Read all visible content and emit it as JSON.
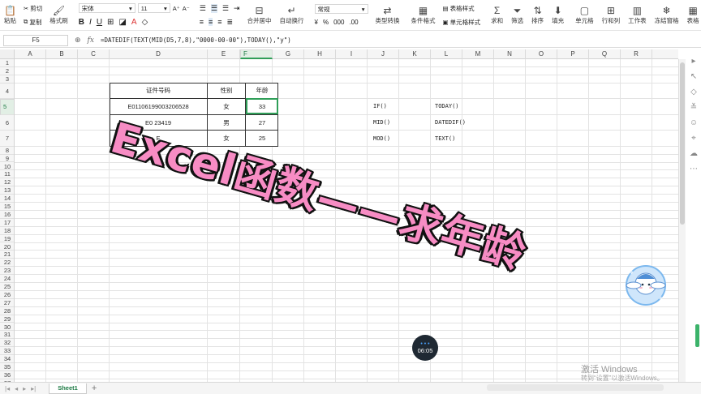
{
  "ribbon": {
    "paste": "粘贴",
    "cut": "剪切",
    "copy": "复制",
    "format_painter": "格式刷",
    "font_name": "宋体",
    "font_size": "11",
    "merge_center": "合并居中",
    "wrap_text": "自动换行",
    "number_format": "常规",
    "type_convert": "类型转换",
    "cond_format": "条件格式",
    "table_style": "表格样式",
    "cell_style": "单元格样式",
    "sum": "求和",
    "filter": "筛选",
    "sort": "排序",
    "fill": "填充",
    "cell": "单元格",
    "row_col": "行和列",
    "worksheet": "工作表",
    "freeze": "冻结窗格",
    "table_tools": "表格"
  },
  "formula_bar": {
    "cell_ref": "F5",
    "fx": "fx",
    "formula": "=DATEDIF(TEXT(MID(D5,7,8),\"0000-00-00\"),TODAY(),\"y\")"
  },
  "columns": [
    "A",
    "B",
    "C",
    "D",
    "E",
    "F",
    "G",
    "H",
    "I",
    "J",
    "K",
    "L",
    "M",
    "N",
    "O",
    "P",
    "Q",
    "R"
  ],
  "rows": [
    "1",
    "2",
    "3",
    "4",
    "5",
    "6",
    "7",
    "8",
    "9",
    "10",
    "11",
    "12",
    "13",
    "14",
    "15",
    "16",
    "17",
    "18",
    "19",
    "20",
    "21",
    "22",
    "23",
    "24",
    "25",
    "26",
    "27",
    "28",
    "29",
    "30",
    "31",
    "32",
    "33",
    "34",
    "35",
    "36",
    "37"
  ],
  "table": {
    "headers": [
      "证件号码",
      "性别",
      "年龄"
    ],
    "rows": [
      [
        "E0110619900320652​8",
        "女",
        "33"
      ],
      [
        "E0    23419",
        "男",
        "27"
      ],
      [
        "E",
        "女",
        "25"
      ]
    ]
  },
  "notes": {
    "j5": "IF()",
    "j6": "MID()",
    "j7": "MOD()",
    "l5": "TODAY()",
    "l6": "DATEDIF()",
    "l7": "TEXT()"
  },
  "overlay_title": "Excel函数——求年龄",
  "sheet_tabs": [
    "Sheet1"
  ],
  "timer": "06:05",
  "watermark": {
    "line1": "激活 Windows",
    "line2": "转到“设置”以激活Windows。"
  },
  "colors": {
    "accent_green": "#2f9e58",
    "overlay_pink": "#f78cc4"
  }
}
